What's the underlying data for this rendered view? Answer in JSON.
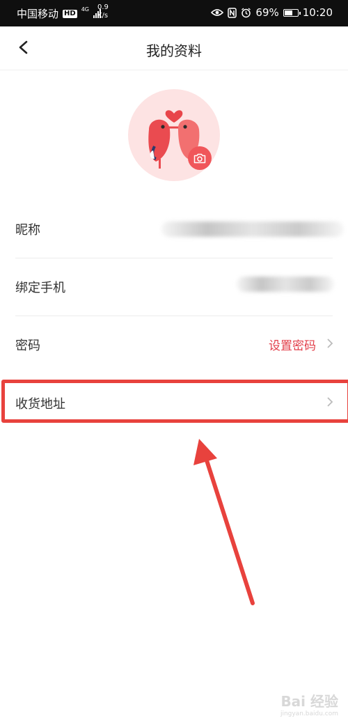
{
  "status_bar": {
    "carrier": "中国移动",
    "hd": "HD",
    "network": "4G",
    "speed_value": "0.9",
    "speed_unit": "K/s",
    "battery_percent": "69%",
    "time": "10:20",
    "battery_level": 0.69
  },
  "header": {
    "title": "我的资料",
    "back_icon": "chevron-left-icon"
  },
  "avatar": {
    "camera_icon": "camera-icon"
  },
  "profile": {
    "rows": [
      {
        "label": "昵称",
        "value": "",
        "chevron": false
      },
      {
        "label": "绑定手机",
        "value": "",
        "chevron": false
      },
      {
        "label": "密码",
        "value": "设置密码",
        "chevron": true
      },
      {
        "label": "收货地址",
        "value": "",
        "chevron": true
      }
    ]
  },
  "colors": {
    "accent": "#e23f4a",
    "highlight": "#e8423d"
  },
  "watermark": {
    "main": "Bai 经验",
    "sub": "jingyan.baidu.com"
  }
}
